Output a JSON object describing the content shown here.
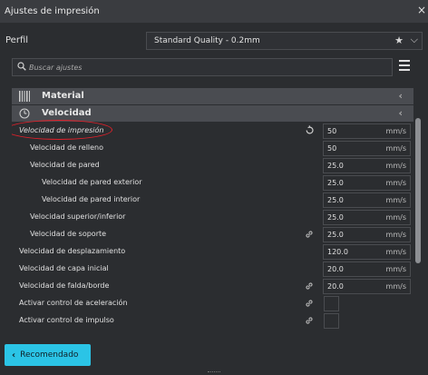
{
  "window": {
    "title": "Ajustes de impresión",
    "close_glyph": "×"
  },
  "profile": {
    "label": "Perfil",
    "selected": "Standard Quality - 0.2mm",
    "star_icon": "star-icon",
    "chevron_icon": "chevron-down-icon"
  },
  "search": {
    "placeholder": "Buscar ajustes",
    "icon": "search-icon"
  },
  "menu_icon": "hamburger-icon",
  "categories": [
    {
      "label": "Material",
      "icon": "material-icon",
      "chevron": "‹"
    },
    {
      "label": "Velocidad",
      "icon": "speed-icon",
      "chevron": "‹"
    }
  ],
  "settings": [
    {
      "label": "Velocidad de impresión",
      "value": "50",
      "unit": "mm/s",
      "indent": 0,
      "italic": true,
      "highlighted": true,
      "icon": "reset-icon"
    },
    {
      "label": "Velocidad de relleno",
      "value": "50",
      "unit": "mm/s",
      "indent": 1
    },
    {
      "label": "Velocidad de pared",
      "value": "25.0",
      "unit": "mm/s",
      "indent": 1
    },
    {
      "label": "Velocidad de pared exterior",
      "value": "25.0",
      "unit": "mm/s",
      "indent": 2
    },
    {
      "label": "Velocidad de pared interior",
      "value": "25.0",
      "unit": "mm/s",
      "indent": 2
    },
    {
      "label": "Velocidad superior/inferior",
      "value": "25.0",
      "unit": "mm/s",
      "indent": 1
    },
    {
      "label": "Velocidad de soporte",
      "value": "25.0",
      "unit": "mm/s",
      "indent": 1,
      "icon": "link-icon"
    },
    {
      "label": "Velocidad de desplazamiento",
      "value": "120.0",
      "unit": "mm/s",
      "indent": 0
    },
    {
      "label": "Velocidad de capa inicial",
      "value": "20.0",
      "unit": "mm/s",
      "indent": 0
    },
    {
      "label": "Velocidad de falda/borde",
      "value": "20.0",
      "unit": "mm/s",
      "indent": 0,
      "icon": "link-icon"
    },
    {
      "label": "Activar control de aceleración",
      "checkbox": true,
      "checked": false,
      "indent": 0,
      "icon": "link-icon"
    },
    {
      "label": "Activar control de impulso",
      "checkbox": true,
      "checked": false,
      "indent": 0,
      "icon": "link-icon"
    }
  ],
  "footer": {
    "recommended_label": "Recomendado",
    "chevron": "‹"
  },
  "colors": {
    "accent": "#2bc4e6",
    "highlight": "#e0202a",
    "background": "#2b2d30",
    "category_bg": "#4a4c51"
  }
}
